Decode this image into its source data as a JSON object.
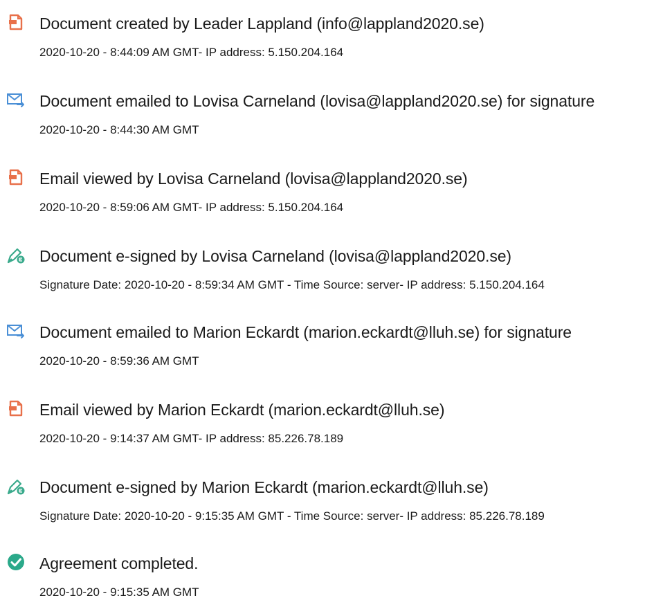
{
  "colors": {
    "document_icon": "#e8704a",
    "email_icon": "#4a8fd6",
    "sign_icon": "#3aaa8c",
    "complete_icon": "#2ba98a",
    "text": "#1a1a1a"
  },
  "events": [
    {
      "icon": "document-icon",
      "title": "Document created by Leader Lappland (info@lappland2020.se)",
      "detail": "2020-10-20 - 8:44:09 AM GMT- IP address: 5.150.204.164"
    },
    {
      "icon": "email-icon",
      "title": "Document emailed to Lovisa Carneland (lovisa@lappland2020.se) for signature",
      "detail": "2020-10-20 - 8:44:30 AM GMT"
    },
    {
      "icon": "document-icon",
      "title": "Email viewed by Lovisa Carneland (lovisa@lappland2020.se)",
      "detail": "2020-10-20 - 8:59:06 AM GMT- IP address: 5.150.204.164"
    },
    {
      "icon": "sign-pen-icon",
      "title": "Document e-signed by Lovisa Carneland (lovisa@lappland2020.se)",
      "detail": "Signature Date: 2020-10-20 - 8:59:34 AM GMT - Time Source: server- IP address: 5.150.204.164"
    },
    {
      "icon": "email-icon",
      "title": "Document emailed to Marion Eckardt (marion.eckardt@lluh.se) for signature",
      "detail": "2020-10-20 - 8:59:36 AM GMT"
    },
    {
      "icon": "document-icon",
      "title": "Email viewed by Marion Eckardt (marion.eckardt@lluh.se)",
      "detail": "2020-10-20 - 9:14:37 AM GMT- IP address: 85.226.78.189"
    },
    {
      "icon": "sign-pen-icon",
      "title": "Document e-signed by Marion Eckardt (marion.eckardt@lluh.se)",
      "detail": "Signature Date: 2020-10-20 - 9:15:35 AM GMT - Time Source: server- IP address: 85.226.78.189"
    },
    {
      "icon": "check-circle-icon",
      "title": "Agreement completed.",
      "detail": "2020-10-20 - 9:15:35 AM GMT"
    }
  ]
}
